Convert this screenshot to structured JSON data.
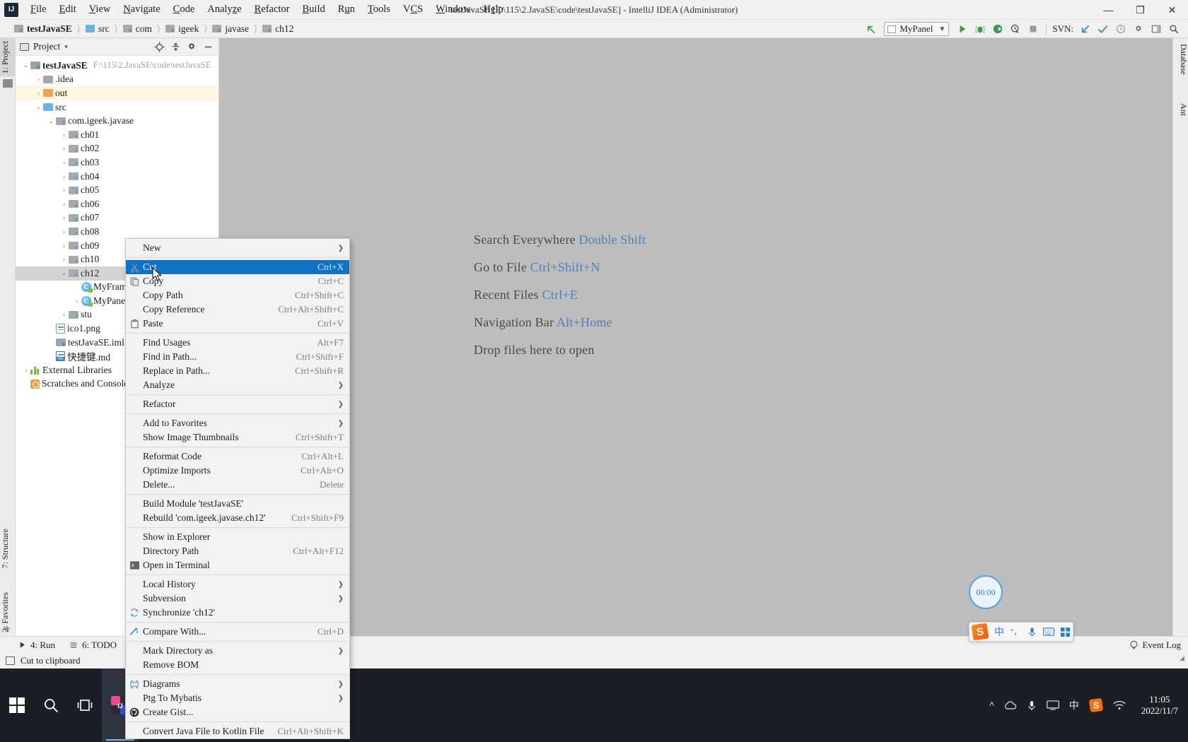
{
  "window": {
    "title": "testJavaSE [F:\\115\\2.JavaSE\\code\\testJavaSE] - IntelliJ IDEA (Administrator)",
    "logo_text": "IJ",
    "minimize": "—",
    "maximize": "❐",
    "close": "✕"
  },
  "menubar": [
    {
      "label": "File"
    },
    {
      "label": "Edit"
    },
    {
      "label": "View"
    },
    {
      "label": "Navigate"
    },
    {
      "label": "Code"
    },
    {
      "label": "Analyze"
    },
    {
      "label": "Refactor"
    },
    {
      "label": "Build"
    },
    {
      "label": "Run"
    },
    {
      "label": "Tools"
    },
    {
      "label": "VCS"
    },
    {
      "label": "Window"
    },
    {
      "label": "Help"
    }
  ],
  "breadcrumbs": [
    {
      "label": "testJavaSE",
      "icon": "module-icon",
      "bold": true
    },
    {
      "label": "src",
      "icon": "source-folder-icon",
      "bold": false
    },
    {
      "label": "com",
      "icon": "folder-icon",
      "bold": false
    },
    {
      "label": "igeek",
      "icon": "folder-icon",
      "bold": false
    },
    {
      "label": "javase",
      "icon": "folder-icon",
      "bold": false
    },
    {
      "label": "ch12",
      "icon": "folder-icon",
      "bold": false
    }
  ],
  "toolbar": {
    "back_icon": "arrow-up-left-icon",
    "run_config": "MyPanel",
    "run_icon": "run-icon",
    "debug_icon": "debug-icon",
    "run_coverage_icon": "run-with-coverage-icon",
    "profile_icon": "profile-icon",
    "stop_icon": "stop-icon",
    "svn_label": "SVN:",
    "svn_update_icon": "update-project-icon",
    "svn_commit_icon": "commit-icon",
    "svn_history_icon": "history-icon",
    "settings_icon": "settings-icon",
    "layout_icon": "layout-icon",
    "search_icon": "search-icon"
  },
  "left_strip": [
    {
      "label": "1: Project",
      "selected": true
    },
    {
      "label": "7: Structure",
      "selected": false
    },
    {
      "label": "2: Favorites",
      "selected": false
    }
  ],
  "right_strip": [
    {
      "label": "Database"
    },
    {
      "label": "Ant"
    }
  ],
  "project_panel": {
    "title": "Project",
    "caret": "▾",
    "icons": [
      "locate-icon",
      "collapse-all-icon",
      "settings-icon",
      "hide-icon"
    ],
    "tree": [
      {
        "depth": 0,
        "arrow": "⌄",
        "icon": "module-icon",
        "name": "testJavaSE",
        "bold": true,
        "path": "F:\\115\\2.JavaSE\\code\\testJavaSE",
        "state": "normal"
      },
      {
        "depth": 1,
        "arrow": "›",
        "icon": "folder-icon",
        "name": ".idea",
        "bold": false,
        "path": "",
        "state": "normal"
      },
      {
        "depth": 1,
        "arrow": "›",
        "icon": "output-folder-icon",
        "name": "out",
        "bold": false,
        "path": "",
        "state": "highlight"
      },
      {
        "depth": 1,
        "arrow": "⌄",
        "icon": "source-folder-icon",
        "name": "src",
        "bold": false,
        "path": "",
        "state": "normal"
      },
      {
        "depth": 2,
        "arrow": "⌄",
        "icon": "package-icon",
        "name": "com.igeek.javase",
        "bold": false,
        "path": "",
        "state": "normal"
      },
      {
        "depth": 3,
        "arrow": "›",
        "icon": "package-icon",
        "name": "ch01",
        "bold": false,
        "path": "",
        "state": "normal"
      },
      {
        "depth": 3,
        "arrow": "›",
        "icon": "package-icon",
        "name": "ch02",
        "bold": false,
        "path": "",
        "state": "normal"
      },
      {
        "depth": 3,
        "arrow": "›",
        "icon": "package-icon",
        "name": "ch03",
        "bold": false,
        "path": "",
        "state": "normal"
      },
      {
        "depth": 3,
        "arrow": "›",
        "icon": "package-icon",
        "name": "ch04",
        "bold": false,
        "path": "",
        "state": "normal"
      },
      {
        "depth": 3,
        "arrow": "›",
        "icon": "package-icon",
        "name": "ch05",
        "bold": false,
        "path": "",
        "state": "normal"
      },
      {
        "depth": 3,
        "arrow": "›",
        "icon": "package-icon",
        "name": "ch06",
        "bold": false,
        "path": "",
        "state": "normal"
      },
      {
        "depth": 3,
        "arrow": "›",
        "icon": "package-icon",
        "name": "ch07",
        "bold": false,
        "path": "",
        "state": "normal"
      },
      {
        "depth": 3,
        "arrow": "›",
        "icon": "package-icon",
        "name": "ch08",
        "bold": false,
        "path": "",
        "state": "normal"
      },
      {
        "depth": 3,
        "arrow": "›",
        "icon": "package-icon",
        "name": "ch09",
        "bold": false,
        "path": "",
        "state": "normal"
      },
      {
        "depth": 3,
        "arrow": "›",
        "icon": "package-icon",
        "name": "ch10",
        "bold": false,
        "path": "",
        "state": "normal"
      },
      {
        "depth": 3,
        "arrow": "⌄",
        "icon": "package-icon",
        "name": "ch12",
        "bold": false,
        "path": "",
        "state": "selected"
      },
      {
        "depth": 4,
        "arrow": "",
        "icon": "java-class-icon",
        "name": "MyFram",
        "bold": false,
        "path": "",
        "state": "normal"
      },
      {
        "depth": 4,
        "arrow": "›",
        "icon": "java-class-icon",
        "name": "MyPanel",
        "bold": false,
        "path": "",
        "state": "normal"
      },
      {
        "depth": 3,
        "arrow": "›",
        "icon": "package-icon",
        "name": "stu",
        "bold": false,
        "path": "",
        "state": "normal"
      },
      {
        "depth": 2,
        "arrow": "",
        "icon": "image-file-icon",
        "name": "ico1.png",
        "bold": false,
        "path": "",
        "state": "normal"
      },
      {
        "depth": 2,
        "arrow": "",
        "icon": "iml-file-icon",
        "name": "testJavaSE.iml",
        "bold": false,
        "path": "",
        "state": "normal"
      },
      {
        "depth": 2,
        "arrow": "",
        "icon": "markdown-file-icon",
        "name": "快捷键.md",
        "bold": false,
        "path": "",
        "state": "normal"
      },
      {
        "depth": 0,
        "arrow": "›",
        "icon": "library-icon",
        "name": "External Libraries",
        "bold": false,
        "path": "",
        "state": "normal"
      },
      {
        "depth": 0,
        "arrow": "",
        "icon": "scratches-icon",
        "name": "Scratches and Consoles",
        "bold": false,
        "path": "",
        "state": "normal"
      }
    ]
  },
  "editor_hints": [
    {
      "text": "Search Everywhere ",
      "key": "Double Shift"
    },
    {
      "text": "Go to File ",
      "key": "Ctrl+Shift+N"
    },
    {
      "text": "Recent Files ",
      "key": "Ctrl+E"
    },
    {
      "text": "Navigation Bar ",
      "key": "Alt+Home"
    },
    {
      "text": "Drop files here to open",
      "key": ""
    }
  ],
  "timer": {
    "value": "00:00"
  },
  "context_menu": [
    {
      "type": "item",
      "label": "New",
      "accel": "",
      "submenu": true,
      "icon": "",
      "selected": false
    },
    {
      "type": "divider"
    },
    {
      "type": "item",
      "label": "Cut",
      "accel": "Ctrl+X",
      "submenu": false,
      "icon": "cut-icon",
      "selected": true
    },
    {
      "type": "item",
      "label": "Copy",
      "accel": "Ctrl+C",
      "submenu": false,
      "icon": "copy-icon",
      "selected": false
    },
    {
      "type": "item",
      "label": "Copy Path",
      "accel": "Ctrl+Shift+C",
      "submenu": false,
      "icon": "",
      "selected": false
    },
    {
      "type": "item",
      "label": "Copy Reference",
      "accel": "Ctrl+Alt+Shift+C",
      "submenu": false,
      "icon": "",
      "selected": false
    },
    {
      "type": "item",
      "label": "Paste",
      "accel": "Ctrl+V",
      "submenu": false,
      "icon": "paste-icon",
      "selected": false
    },
    {
      "type": "divider"
    },
    {
      "type": "item",
      "label": "Find Usages",
      "accel": "Alt+F7",
      "submenu": false,
      "icon": "",
      "selected": false
    },
    {
      "type": "item",
      "label": "Find in Path...",
      "accel": "Ctrl+Shift+F",
      "submenu": false,
      "icon": "",
      "selected": false
    },
    {
      "type": "item",
      "label": "Replace in Path...",
      "accel": "Ctrl+Shift+R",
      "submenu": false,
      "icon": "",
      "selected": false
    },
    {
      "type": "item",
      "label": "Analyze",
      "accel": "",
      "submenu": true,
      "icon": "",
      "selected": false
    },
    {
      "type": "divider"
    },
    {
      "type": "item",
      "label": "Refactor",
      "accel": "",
      "submenu": true,
      "icon": "",
      "selected": false
    },
    {
      "type": "divider"
    },
    {
      "type": "item",
      "label": "Add to Favorites",
      "accel": "",
      "submenu": true,
      "icon": "",
      "selected": false
    },
    {
      "type": "item",
      "label": "Show Image Thumbnails",
      "accel": "Ctrl+Shift+T",
      "submenu": false,
      "icon": "",
      "selected": false
    },
    {
      "type": "divider"
    },
    {
      "type": "item",
      "label": "Reformat Code",
      "accel": "Ctrl+Alt+L",
      "submenu": false,
      "icon": "",
      "selected": false
    },
    {
      "type": "item",
      "label": "Optimize Imports",
      "accel": "Ctrl+Alt+O",
      "submenu": false,
      "icon": "",
      "selected": false
    },
    {
      "type": "item",
      "label": "Delete...",
      "accel": "Delete",
      "submenu": false,
      "icon": "",
      "selected": false
    },
    {
      "type": "divider"
    },
    {
      "type": "item",
      "label": "Build Module 'testJavaSE'",
      "accel": "",
      "submenu": false,
      "icon": "",
      "selected": false
    },
    {
      "type": "item",
      "label": "Rebuild 'com.igeek.javase.ch12'",
      "accel": "Ctrl+Shift+F9",
      "submenu": false,
      "icon": "",
      "selected": false
    },
    {
      "type": "divider"
    },
    {
      "type": "item",
      "label": "Show in Explorer",
      "accel": "",
      "submenu": false,
      "icon": "",
      "selected": false
    },
    {
      "type": "item",
      "label": "Directory Path",
      "accel": "Ctrl+Alt+F12",
      "submenu": false,
      "icon": "",
      "selected": false
    },
    {
      "type": "item",
      "label": "Open in Terminal",
      "accel": "",
      "submenu": false,
      "icon": "terminal-icon",
      "selected": false
    },
    {
      "type": "divider"
    },
    {
      "type": "item",
      "label": "Local History",
      "accel": "",
      "submenu": true,
      "icon": "",
      "selected": false
    },
    {
      "type": "item",
      "label": "Subversion",
      "accel": "",
      "submenu": true,
      "icon": "",
      "selected": false
    },
    {
      "type": "item",
      "label": "Synchronize 'ch12'",
      "accel": "",
      "submenu": false,
      "icon": "sync-icon",
      "selected": false
    },
    {
      "type": "divider"
    },
    {
      "type": "item",
      "label": "Compare With...",
      "accel": "Ctrl+D",
      "submenu": false,
      "icon": "compare-icon",
      "selected": false
    },
    {
      "type": "divider"
    },
    {
      "type": "item",
      "label": "Mark Directory as",
      "accel": "",
      "submenu": true,
      "icon": "",
      "selected": false
    },
    {
      "type": "item",
      "label": "Remove BOM",
      "accel": "",
      "submenu": false,
      "icon": "",
      "selected": false
    },
    {
      "type": "divider"
    },
    {
      "type": "item",
      "label": "Diagrams",
      "accel": "",
      "submenu": true,
      "icon": "diagram-icon",
      "selected": false
    },
    {
      "type": "item",
      "label": "Ptg To Mybatis",
      "accel": "",
      "submenu": true,
      "icon": "",
      "selected": false
    },
    {
      "type": "item",
      "label": "Create Gist...",
      "accel": "",
      "submenu": false,
      "icon": "github-icon",
      "selected": false
    },
    {
      "type": "divider"
    },
    {
      "type": "item",
      "label": "Convert Java File to Kotlin File",
      "accel": "Ctrl+Alt+Shift+K",
      "submenu": false,
      "icon": "",
      "selected": false
    }
  ],
  "bottom_bar": {
    "run": "4: Run",
    "todo": "6: TODO",
    "terminal_icon": "terminal-icon",
    "event_log": "Event Log",
    "event_log_icon": "balloon-icon"
  },
  "status_bar": {
    "message": "Cut to clipboard",
    "icon": "clipboard-icon"
  },
  "taskbar": {
    "start_icon": "windows-start-icon",
    "search_icon": "search-icon",
    "taskview_icon": "task-view-icon",
    "app_icon": "intellij-idea-icon",
    "tray": {
      "chevron_icon": "show-hidden-icons-icon",
      "onedrive_icon": "onedrive-icon",
      "mic_icon": "microphone-icon",
      "display_icon": "display-icon",
      "ime_label": "中",
      "sogou_icon": "sogou-pinyin-icon",
      "network_icon": "network-icon",
      "time": "11:05",
      "date": "2022/11/7"
    }
  },
  "ime_bar": {
    "logo": "S",
    "mode": "中",
    "punct": "°，",
    "mic_icon": "microphone-icon",
    "keyboard_icon": "keyboard-icon",
    "menu_icon": "menu-grid-icon"
  },
  "colors": {
    "accent": "#1172c4",
    "hint_key": "#4a7fbe",
    "editor_bg": "#bdbdbd",
    "panel_bg": "#f0f0f0"
  }
}
